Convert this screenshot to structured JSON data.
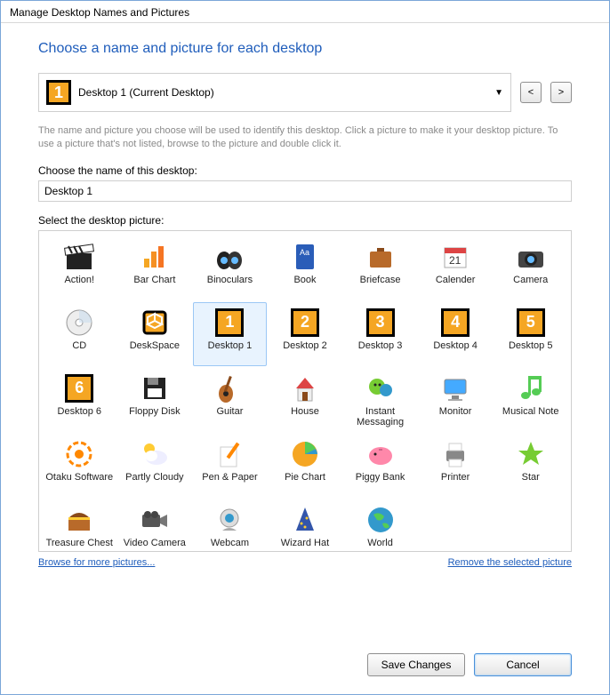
{
  "title": "Manage Desktop Names and Pictures",
  "heading": "Choose a name and picture for each desktop",
  "selector": {
    "badge": "1",
    "label": "Desktop 1 (Current Desktop)",
    "prev": "<",
    "next": ">"
  },
  "help_text": "The name and picture you choose will be used to identify this desktop. Click a picture to make it your desktop picture. To use a picture that's not listed, browse to the picture and double click it.",
  "name_field": {
    "label": "Choose the name of this desktop:",
    "value": "Desktop 1"
  },
  "picture_label": "Select the desktop picture:",
  "icons": [
    {
      "name": "action-icon",
      "label": "Action!",
      "type": "svg",
      "svg": "clapper"
    },
    {
      "name": "bar-chart-icon",
      "label": "Bar Chart",
      "type": "svg",
      "svg": "barchart"
    },
    {
      "name": "binoculars-icon",
      "label": "Binoculars",
      "type": "svg",
      "svg": "binocs"
    },
    {
      "name": "book-icon",
      "label": "Book",
      "type": "svg",
      "svg": "book"
    },
    {
      "name": "briefcase-icon",
      "label": "Briefcase",
      "type": "svg",
      "svg": "briefcase"
    },
    {
      "name": "calendar-icon",
      "label": "Calender",
      "type": "svg",
      "svg": "calendar"
    },
    {
      "name": "camera-icon",
      "label": "Camera",
      "type": "svg",
      "svg": "camera"
    },
    {
      "name": "cd-icon",
      "label": "CD",
      "type": "svg",
      "svg": "cd"
    },
    {
      "name": "deskspace-icon",
      "label": "DeskSpace",
      "type": "svg",
      "svg": "cube"
    },
    {
      "name": "desktop-1-icon",
      "label": "Desktop 1",
      "type": "num",
      "num": "1",
      "selected": true
    },
    {
      "name": "desktop-2-icon",
      "label": "Desktop 2",
      "type": "num",
      "num": "2"
    },
    {
      "name": "desktop-3-icon",
      "label": "Desktop 3",
      "type": "num",
      "num": "3"
    },
    {
      "name": "desktop-4-icon",
      "label": "Desktop 4",
      "type": "num",
      "num": "4"
    },
    {
      "name": "desktop-5-icon",
      "label": "Desktop 5",
      "type": "num",
      "num": "5"
    },
    {
      "name": "desktop-6-icon",
      "label": "Desktop 6",
      "type": "num",
      "num": "6"
    },
    {
      "name": "floppy-disk-icon",
      "label": "Floppy Disk",
      "type": "svg",
      "svg": "floppy"
    },
    {
      "name": "guitar-icon",
      "label": "Guitar",
      "type": "svg",
      "svg": "guitar"
    },
    {
      "name": "house-icon",
      "label": "House",
      "type": "svg",
      "svg": "house"
    },
    {
      "name": "instant-messaging-icon",
      "label": "Instant Messaging",
      "type": "svg",
      "svg": "im"
    },
    {
      "name": "monitor-icon",
      "label": "Monitor",
      "type": "svg",
      "svg": "monitor"
    },
    {
      "name": "musical-note-icon",
      "label": "Musical Note",
      "type": "svg",
      "svg": "note"
    },
    {
      "name": "otaku-software-icon",
      "label": "Otaku Software",
      "type": "svg",
      "svg": "otaku"
    },
    {
      "name": "partly-cloudy-icon",
      "label": "Partly Cloudy",
      "type": "svg",
      "svg": "cloud"
    },
    {
      "name": "pen-paper-icon",
      "label": "Pen & Paper",
      "type": "svg",
      "svg": "pen"
    },
    {
      "name": "pie-chart-icon",
      "label": "Pie Chart",
      "type": "svg",
      "svg": "pie"
    },
    {
      "name": "piggy-bank-icon",
      "label": "Piggy Bank",
      "type": "svg",
      "svg": "piggy"
    },
    {
      "name": "printer-icon",
      "label": "Printer",
      "type": "svg",
      "svg": "printer"
    },
    {
      "name": "star-icon",
      "label": "Star",
      "type": "svg",
      "svg": "star"
    },
    {
      "name": "treasure-chest-icon",
      "label": "Treasure Chest",
      "type": "svg",
      "svg": "chest"
    },
    {
      "name": "video-camera-icon",
      "label": "Video Camera",
      "type": "svg",
      "svg": "vcam"
    },
    {
      "name": "webcam-icon",
      "label": "Webcam",
      "type": "svg",
      "svg": "webcam"
    },
    {
      "name": "wizard-hat-icon",
      "label": "Wizard Hat",
      "type": "svg",
      "svg": "wizard"
    },
    {
      "name": "world-icon",
      "label": "World",
      "type": "svg",
      "svg": "world"
    }
  ],
  "links": {
    "browse": "Browse for more pictures...",
    "remove": "Remove the selected picture"
  },
  "buttons": {
    "save": "Save Changes",
    "cancel": "Cancel"
  }
}
